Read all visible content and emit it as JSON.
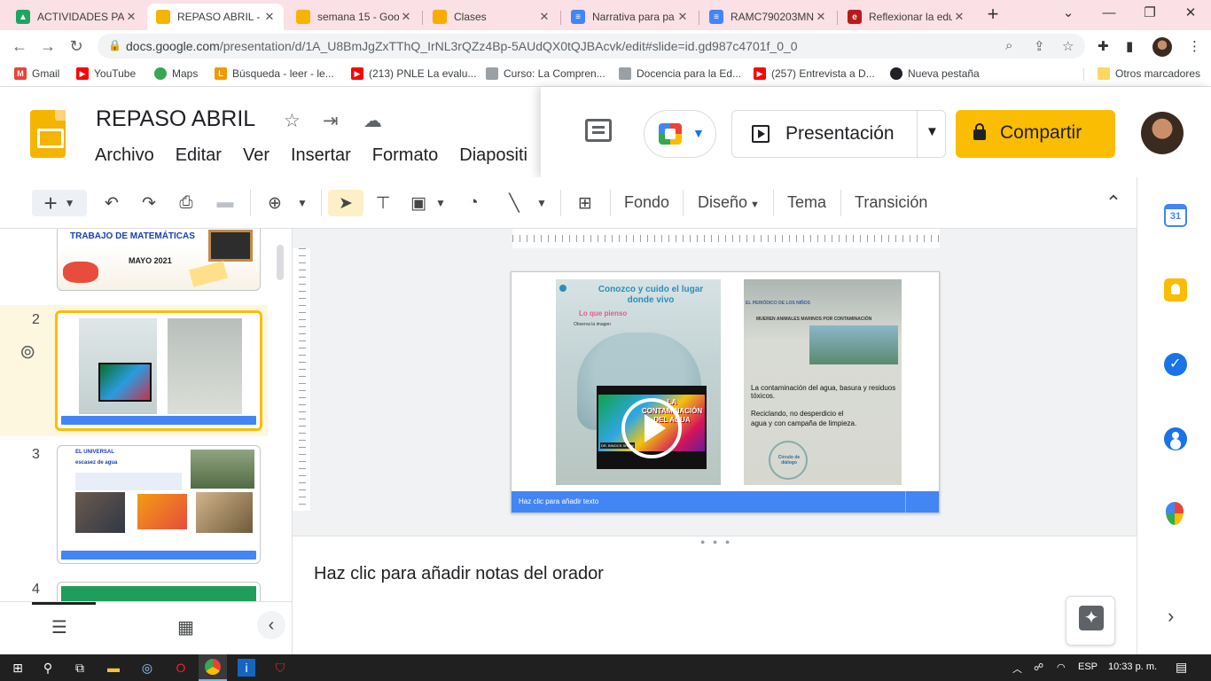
{
  "browser": {
    "tabs": [
      {
        "title": "ACTIVIDADES PAR",
        "favicon": "google-drive-icon",
        "color": "#1fa463",
        "active": false
      },
      {
        "title": "REPASO ABRIL - ",
        "favicon": "google-slides-icon",
        "color": "#f4b400",
        "active": true
      },
      {
        "title": "semana 15 - Goo",
        "favicon": "google-drive-folder-icon",
        "color": "#f4b400",
        "active": false
      },
      {
        "title": "Clases",
        "favicon": "google-classroom-icon",
        "color": "#f9ab00",
        "active": false
      },
      {
        "title": "Narrativa para pa",
        "favicon": "google-docs-icon",
        "color": "#4285f4",
        "active": false
      },
      {
        "title": "RAMC790203MN",
        "favicon": "google-docs-icon",
        "color": "#4285f4",
        "active": false
      },
      {
        "title": "Reflexionar la edu",
        "favicon": "e-site-icon",
        "color": "#b71c1c",
        "active": false
      }
    ],
    "url_main": "docs.google.com",
    "url_path": "/presentation/d/1A_U8BmJgZxTThQ_IrNL3rQZz4Bp-5AUdQX0tQJBAcvk/edit#slide=id.gd987c4701f_0_0",
    "bookmarks": [
      {
        "label": "Gmail",
        "icon": "gmail-icon",
        "color": "#ea4335"
      },
      {
        "label": "YouTube",
        "icon": "youtube-icon",
        "color": "#ff0000"
      },
      {
        "label": "Maps",
        "icon": "maps-icon",
        "color": "#34a853"
      },
      {
        "label": "Búsqueda - leer - le...",
        "icon": "lp-icon",
        "color": "#f29900"
      },
      {
        "label": "(213) PNLE La evalu...",
        "icon": "youtube-icon",
        "color": "#ff0000"
      },
      {
        "label": "Curso: La Compren...",
        "icon": "course-icon",
        "color": "#9aa0a6"
      },
      {
        "label": "Docencia para la Ed...",
        "icon": "course-icon",
        "color": "#9aa0a6"
      },
      {
        "label": "(257) Entrevista a D...",
        "icon": "youtube-icon",
        "color": "#ff0000"
      },
      {
        "label": "Nueva pestaña",
        "icon": "globe-icon",
        "color": "#202124"
      }
    ],
    "other_bookmarks": "Otros marcadores"
  },
  "doc": {
    "title": "REPASO ABRIL",
    "menu": [
      "Archivo",
      "Editar",
      "Ver",
      "Insertar",
      "Formato",
      "Diapositi"
    ],
    "present_label": "Presentación",
    "share_label": "Compartir"
  },
  "toolbar": {
    "fondo": "Fondo",
    "diseno": "Diseño",
    "tema": "Tema",
    "transicion": "Transición"
  },
  "filmstrip": {
    "slides": [
      {
        "number": "2"
      },
      {
        "number": "3"
      },
      {
        "number": "4"
      }
    ],
    "slide1_text": "TRABAJO DE MATEMÁTICAS",
    "slide1_date": "MAYO 2021",
    "slide3_header": "EL UNIVERSAL",
    "slide3_subheader": "escasez de agua"
  },
  "slide": {
    "left_title": "Conozco y cuido el lugar donde vivo",
    "left_subtitle": "Lo que pienso",
    "left_small": "Observa la imagen",
    "video_title": "LA CONTAMINACIÓN DEL AGUA",
    "video_badge": "DR. BINOCS SHOW",
    "right_header": "EL PERIÓDICO DE LOS NIÑOS",
    "right_headline": "MUEREN ANIMALES MARINOS POR CONTAMINACIÓN",
    "answer1": "La contaminación del agua, basura y residuos tóxicos.",
    "answer2": "Reciclando, no desperdicio el agua y con campaña de limpieza.",
    "circle_label": "Círculo de diálogo",
    "caption": "Haz clic para añadir texto"
  },
  "notes": {
    "placeholder": "Haz clic para añadir notas del orador"
  },
  "taskbar": {
    "lang": "ESP",
    "time": "10:33 p. m."
  }
}
